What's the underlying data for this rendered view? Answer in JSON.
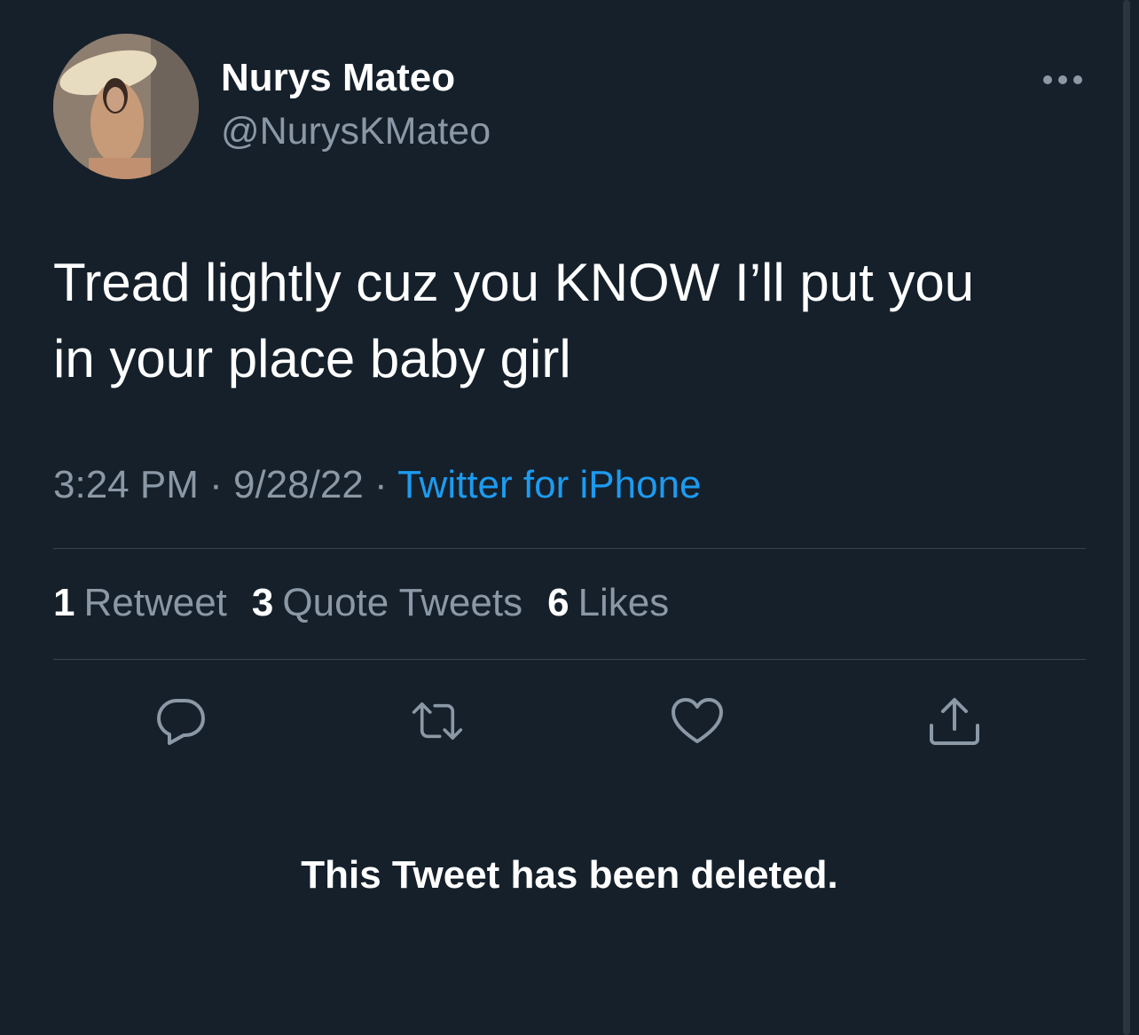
{
  "author": {
    "display_name": "Nurys Mateo",
    "handle": "@NurysKMateo"
  },
  "tweet": {
    "line1": "Tread lightly cuz you KNOW I’ll put you",
    "line2": "in your place baby girl"
  },
  "meta": {
    "time": "3:24 PM",
    "separator": " · ",
    "date": "9/28/22",
    "source": "Twitter for iPhone"
  },
  "stats": {
    "retweets_count": "1",
    "retweets_label": "Retweet",
    "quotes_count": "3",
    "quotes_label": "Quote Tweets",
    "likes_count": "6",
    "likes_label": "Likes"
  },
  "actions": {
    "icons": [
      "reply-icon",
      "retweet-icon",
      "like-icon",
      "share-icon"
    ]
  },
  "deleted_notice": "This Tweet has been deleted.",
  "colors": {
    "background": "#15202b",
    "secondary_text": "#8b98a5",
    "link": "#1d9bf0",
    "divider": "#38444d"
  }
}
